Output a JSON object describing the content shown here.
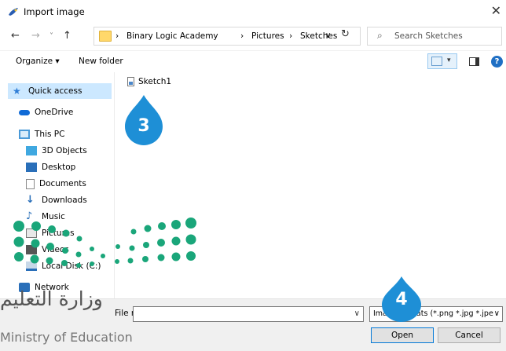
{
  "window": {
    "title": "Import image",
    "close_glyph": "✕"
  },
  "nav": {
    "back_glyph": "←",
    "forward_glyph": "→",
    "recent_glyph": "˅",
    "up_glyph": "↑",
    "breadcrumb": [
      "Binary Logic Academy",
      "Pictures",
      "Sketches"
    ],
    "separator": "›",
    "address_dropdown": "∨",
    "refresh_glyph": "↻",
    "search_placeholder": "Search Sketches"
  },
  "toolbar": {
    "organize_label": "Organize ▾",
    "new_folder_label": "New folder",
    "help_label": "?"
  },
  "sidebar": {
    "items": [
      {
        "label": "Quick access",
        "icon": "star-icon",
        "color": "#2e7dd6",
        "selected": true
      },
      {
        "label": "OneDrive",
        "icon": "cloud-icon",
        "color": "#0f6ad6"
      },
      {
        "label": "This PC",
        "icon": "monitor-icon",
        "color": "#4a9ad8"
      },
      {
        "label": "3D Objects",
        "icon": "cube-icon",
        "color": "#3fa8e0"
      },
      {
        "label": "Desktop",
        "icon": "desktop-icon",
        "color": "#2a6fb9"
      },
      {
        "label": "Documents",
        "icon": "document-icon",
        "color": "#8a8a8a"
      },
      {
        "label": "Downloads",
        "icon": "download-icon",
        "color": "#2a6fb9"
      },
      {
        "label": "Music",
        "icon": "music-icon",
        "color": "#2a6fb9"
      },
      {
        "label": "Pictures",
        "icon": "pictures-icon",
        "color": "#777777"
      },
      {
        "label": "Videos",
        "icon": "video-icon",
        "color": "#555555"
      },
      {
        "label": "Local Disk (C:)",
        "icon": "disk-icon",
        "color": "#2a6fb9"
      },
      {
        "label": "Network",
        "icon": "network-icon",
        "color": "#2a6fb9"
      }
    ]
  },
  "content": {
    "files": [
      {
        "name": "Sketch1",
        "icon": "image-file-icon"
      }
    ]
  },
  "markers": {
    "step3": "3",
    "step4": "4",
    "color": "#1e8fd6"
  },
  "bottom": {
    "file_name_label": "File name:",
    "file_name_value": "",
    "filter_value": "Image formats (*.png *.jpg *.jpe",
    "open_label": "Open",
    "cancel_label": "Cancel"
  },
  "logo": {
    "arabic_text": "وزارة التعليم",
    "english_text": "Ministry of Education",
    "dot_color": "#1aa67a"
  }
}
